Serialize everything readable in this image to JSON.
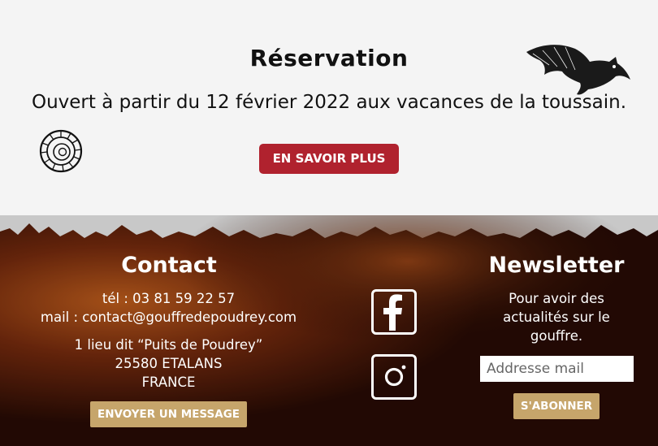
{
  "reservation": {
    "title": "Réservation",
    "subtitle": "Ouvert à partir du 12 février 2022 aux vacances de la toussain.",
    "cta_label": "EN SAVOIR PLUS"
  },
  "contact": {
    "title": "Contact",
    "phone": "tél : 03 81 59 22 57",
    "email": "mail : contact@gouffredepoudrey.com",
    "address_line1": "1 lieu dit “Puits de Poudrey”",
    "address_line2": "25580 ETALANS",
    "address_line3": "FRANCE",
    "button_label": "ENVOYER UN MESSAGE"
  },
  "social": {
    "facebook_icon": "facebook-icon",
    "instagram_icon": "instagram-icon"
  },
  "newsletter": {
    "title": "Newsletter",
    "text_line1": "Pour avoir des",
    "text_line2": "actualités sur le",
    "text_line3": "gouffre.",
    "input_placeholder": "Addresse mail",
    "button_label": "S'ABONNER"
  },
  "colors": {
    "primary_button": "#b0222e",
    "gold_button": "#c6a56b"
  }
}
